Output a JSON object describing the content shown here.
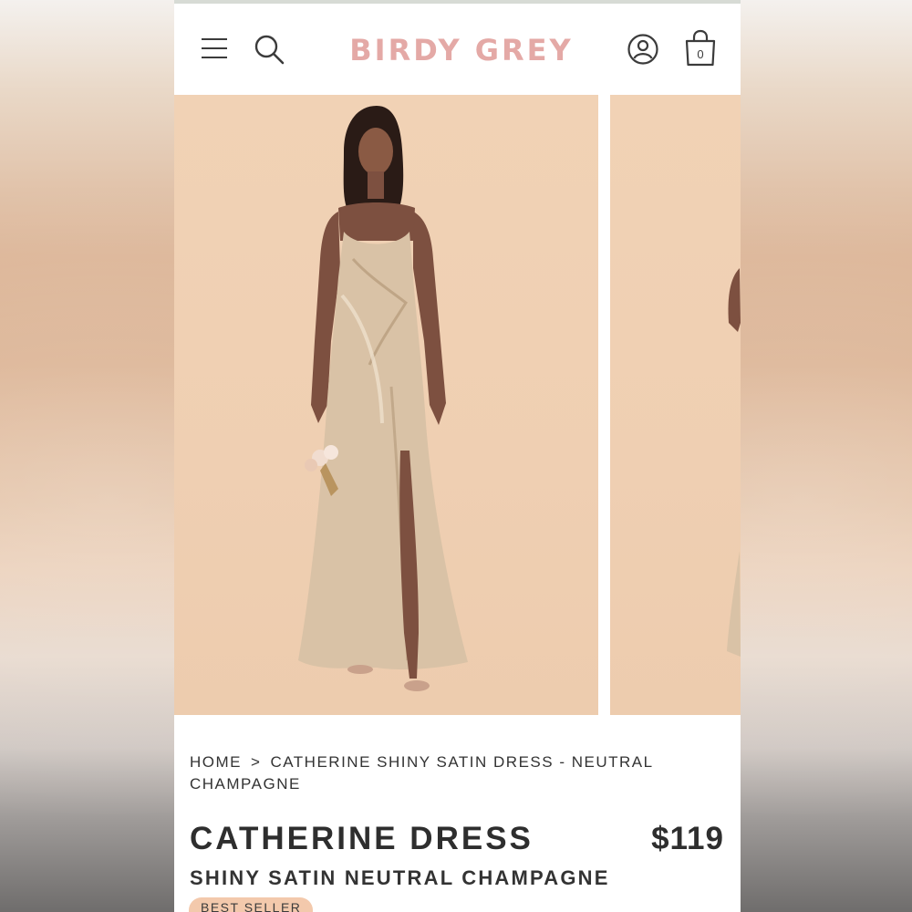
{
  "header": {
    "logo": "BIRDY GREY",
    "bag_count": "0",
    "icons": [
      "menu-icon",
      "search-icon",
      "account-icon",
      "shopping-bag-icon"
    ]
  },
  "breadcrumb": {
    "home": "HOME",
    "separator": ">",
    "current": "CATHERINE SHINY SATIN DRESS - NEUTRAL CHAMPAGNE"
  },
  "product": {
    "title": "CATHERINE DRESS",
    "price": "$119",
    "subtitle": "SHINY SATIN NEUTRAL CHAMPAGNE",
    "badge": "BEST SELLER"
  },
  "colors": {
    "brand": "#e4a9a6",
    "photo_background": "#f0d0b3",
    "dress": "#d9c2a6",
    "badge_background": "#f3c9ac",
    "text": "#2e2e2e"
  }
}
